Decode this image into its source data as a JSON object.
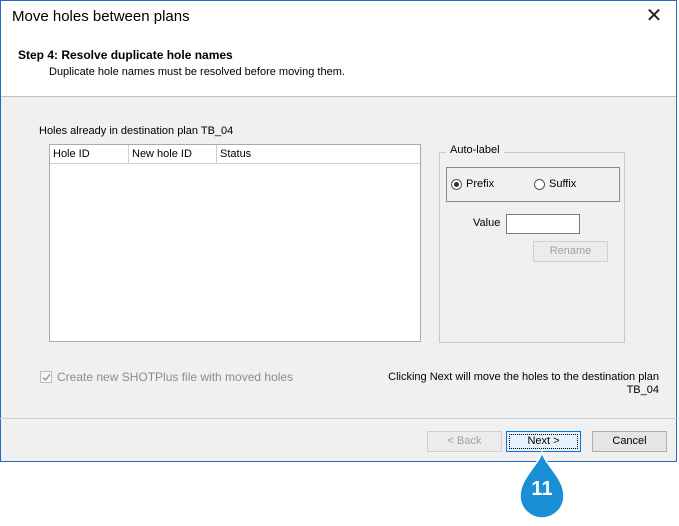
{
  "window": {
    "title": "Move holes between plans"
  },
  "header": {
    "step_title": "Step 4: Resolve duplicate hole names",
    "step_subtitle": "Duplicate hole names must be resolved before moving them."
  },
  "list": {
    "caption": "Holes already in destination plan TB_04",
    "columns": [
      "Hole ID",
      "New hole ID",
      "Status"
    ],
    "rows": []
  },
  "autolabel": {
    "title": "Auto-label",
    "prefix_label": "Prefix",
    "suffix_label": "Suffix",
    "selected": "Prefix",
    "value_label": "Value",
    "value": "",
    "rename_label": "Rename"
  },
  "options": {
    "create_file_label": "Create new SHOTPlus file with moved holes",
    "create_file_checked": true
  },
  "note": "Clicking Next will move the holes to the destination plan TB_04",
  "buttons": {
    "back": "< Back",
    "next": "Next >",
    "cancel": "Cancel"
  },
  "callout": {
    "number": "11",
    "color": "#1a8fd6"
  },
  "colors": {
    "accent": "#0078d7",
    "border": "#1e6fc4"
  }
}
